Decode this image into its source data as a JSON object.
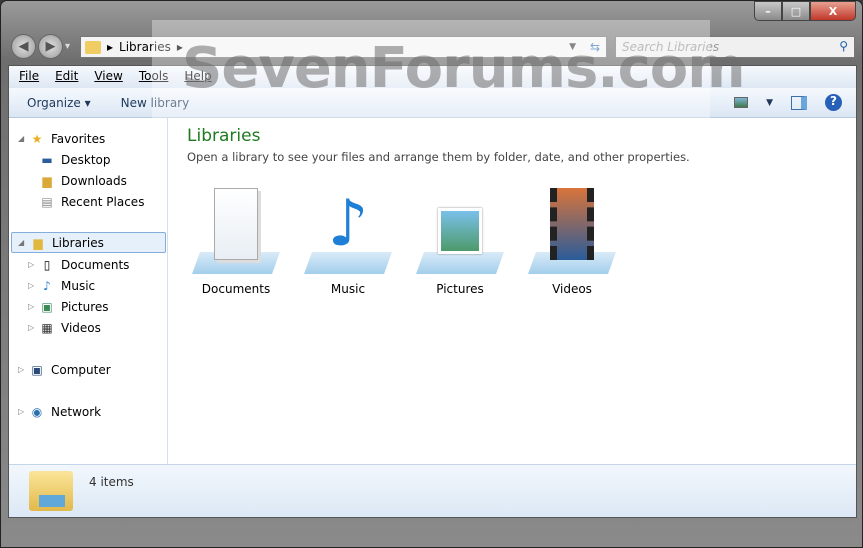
{
  "window": {
    "minimize": "–",
    "maximize": "□",
    "close": "X"
  },
  "nav": {
    "back": "◀",
    "forward": "▶",
    "history": "▾"
  },
  "address": {
    "crumb": "Libraries",
    "sep": "▸"
  },
  "search": {
    "placeholder": "Search Libraries"
  },
  "menu": [
    "File",
    "Edit",
    "View",
    "Tools",
    "Help"
  ],
  "toolbar": {
    "organize": "Organize ▾",
    "new_library": "New library"
  },
  "sidebar": {
    "favorites": {
      "label": "Favorites",
      "items": [
        "Desktop",
        "Downloads",
        "Recent Places"
      ]
    },
    "libraries": {
      "label": "Libraries",
      "items": [
        "Documents",
        "Music",
        "Pictures",
        "Videos"
      ]
    },
    "computer": "Computer",
    "network": "Network"
  },
  "content": {
    "title": "Libraries",
    "subtitle": "Open a library to see your files and arrange them by folder, date, and other properties.",
    "libraries": [
      "Documents",
      "Music",
      "Pictures",
      "Videos"
    ]
  },
  "status": {
    "count": "4 items"
  },
  "watermark": "SevenForums.com"
}
